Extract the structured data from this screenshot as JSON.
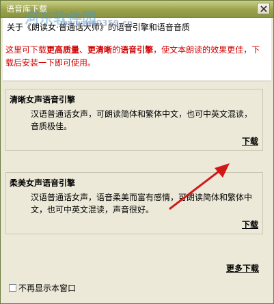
{
  "window": {
    "title": "语音库下载"
  },
  "header": {
    "title": "关于《朗读女·普通话大师》的语音引擎和语音音质",
    "desc_prefix": "这里可下载",
    "desc_em1": "更高质量",
    "desc_sep": "、",
    "desc_em2": "更清晰",
    "desc_mid": "的",
    "desc_em3": "语音引擎",
    "desc_suffix": "，使文本朗读的效果更佳，下载后安装一下即可使用。"
  },
  "cards": [
    {
      "title": "清晰女声语音引擎",
      "body": "汉语普通话女声，可朗读简体和繁体中文，也可中英文混读，音质极佳。",
      "link": "下载"
    },
    {
      "title": "柔美女声语音引擎",
      "body": "汉语普通话女声，语音柔美而富有感情，可朗读简体和繁体中文，也可中英文混读，声音很好。",
      "link": "下载"
    }
  ],
  "more_link": "更多下载",
  "dont_show": {
    "label": "不再显示本窗口",
    "checked": false
  },
  "watermark": {
    "text": "河东软件园",
    "url": "www.pc0359.cn"
  },
  "colors": {
    "titlebar": "#9aa24c",
    "dialog_bg": "#ece9d8",
    "highlight_red": "#d00000",
    "annotation_arrow": "#d01818"
  }
}
